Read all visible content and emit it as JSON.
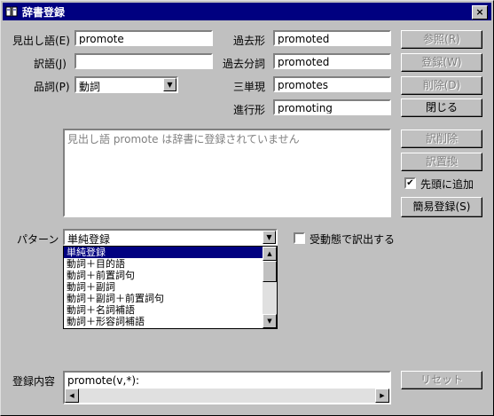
{
  "window": {
    "title": "辞書登録",
    "close_label": "×"
  },
  "fields": {
    "headword": {
      "label": "見出し語(E)",
      "value": "promote"
    },
    "translation": {
      "label": "訳語(J)",
      "value": ""
    },
    "pos": {
      "label": "品詞(P)",
      "value": "動詞"
    },
    "past": {
      "label": "過去形",
      "value": "promoted"
    },
    "past_participle": {
      "label": "過去分詞",
      "value": "promoted"
    },
    "third_singular": {
      "label": "三単現",
      "value": "promotes"
    },
    "progressive": {
      "label": "進行形",
      "value": "promoting"
    }
  },
  "buttons": {
    "reference": "参照(R)",
    "register": "登録(W)",
    "delete": "削除(D)",
    "close": "閉じる",
    "delete_translation": "訳削除",
    "replace_translation": "訳置換",
    "simple_register": "簡易登録(S)",
    "reset": "リセット"
  },
  "message": "見出し語 promote は辞書に登録されていません",
  "prepend": {
    "label": "先頭に追加",
    "checked": true
  },
  "pattern": {
    "label": "パターン",
    "value": "単純登録",
    "options": [
      "単純登録",
      "動詞＋目的語",
      "動詞＋前置詞句",
      "動詞＋副詞",
      "動詞＋副詞＋前置詞句",
      "動詞＋名詞補語",
      "動詞＋形容詞補語"
    ],
    "selected_index": 0
  },
  "passive": {
    "label": "受動態で訳出する",
    "checked": false
  },
  "registration": {
    "label": "登録内容",
    "value": "promote(v,*):"
  }
}
